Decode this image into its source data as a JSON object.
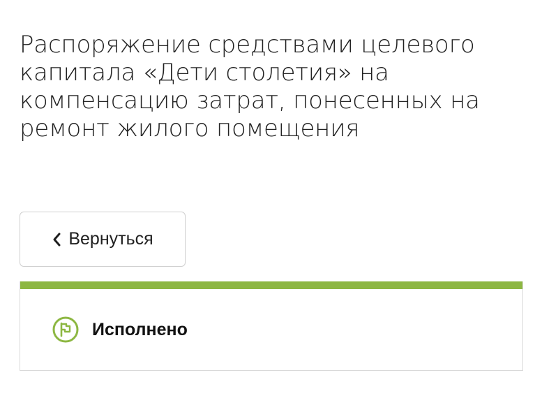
{
  "page": {
    "title": "Распоряжение средствами целевого капитала «Дети столетия» на компенсацию затрат, понесенных на ремонт жилого помещения"
  },
  "back_button": {
    "label": "Вернуться",
    "icon": "chevron-left-icon"
  },
  "status": {
    "label": "Исполнено",
    "icon": "flag-icon",
    "accent_color": "#8db742"
  }
}
